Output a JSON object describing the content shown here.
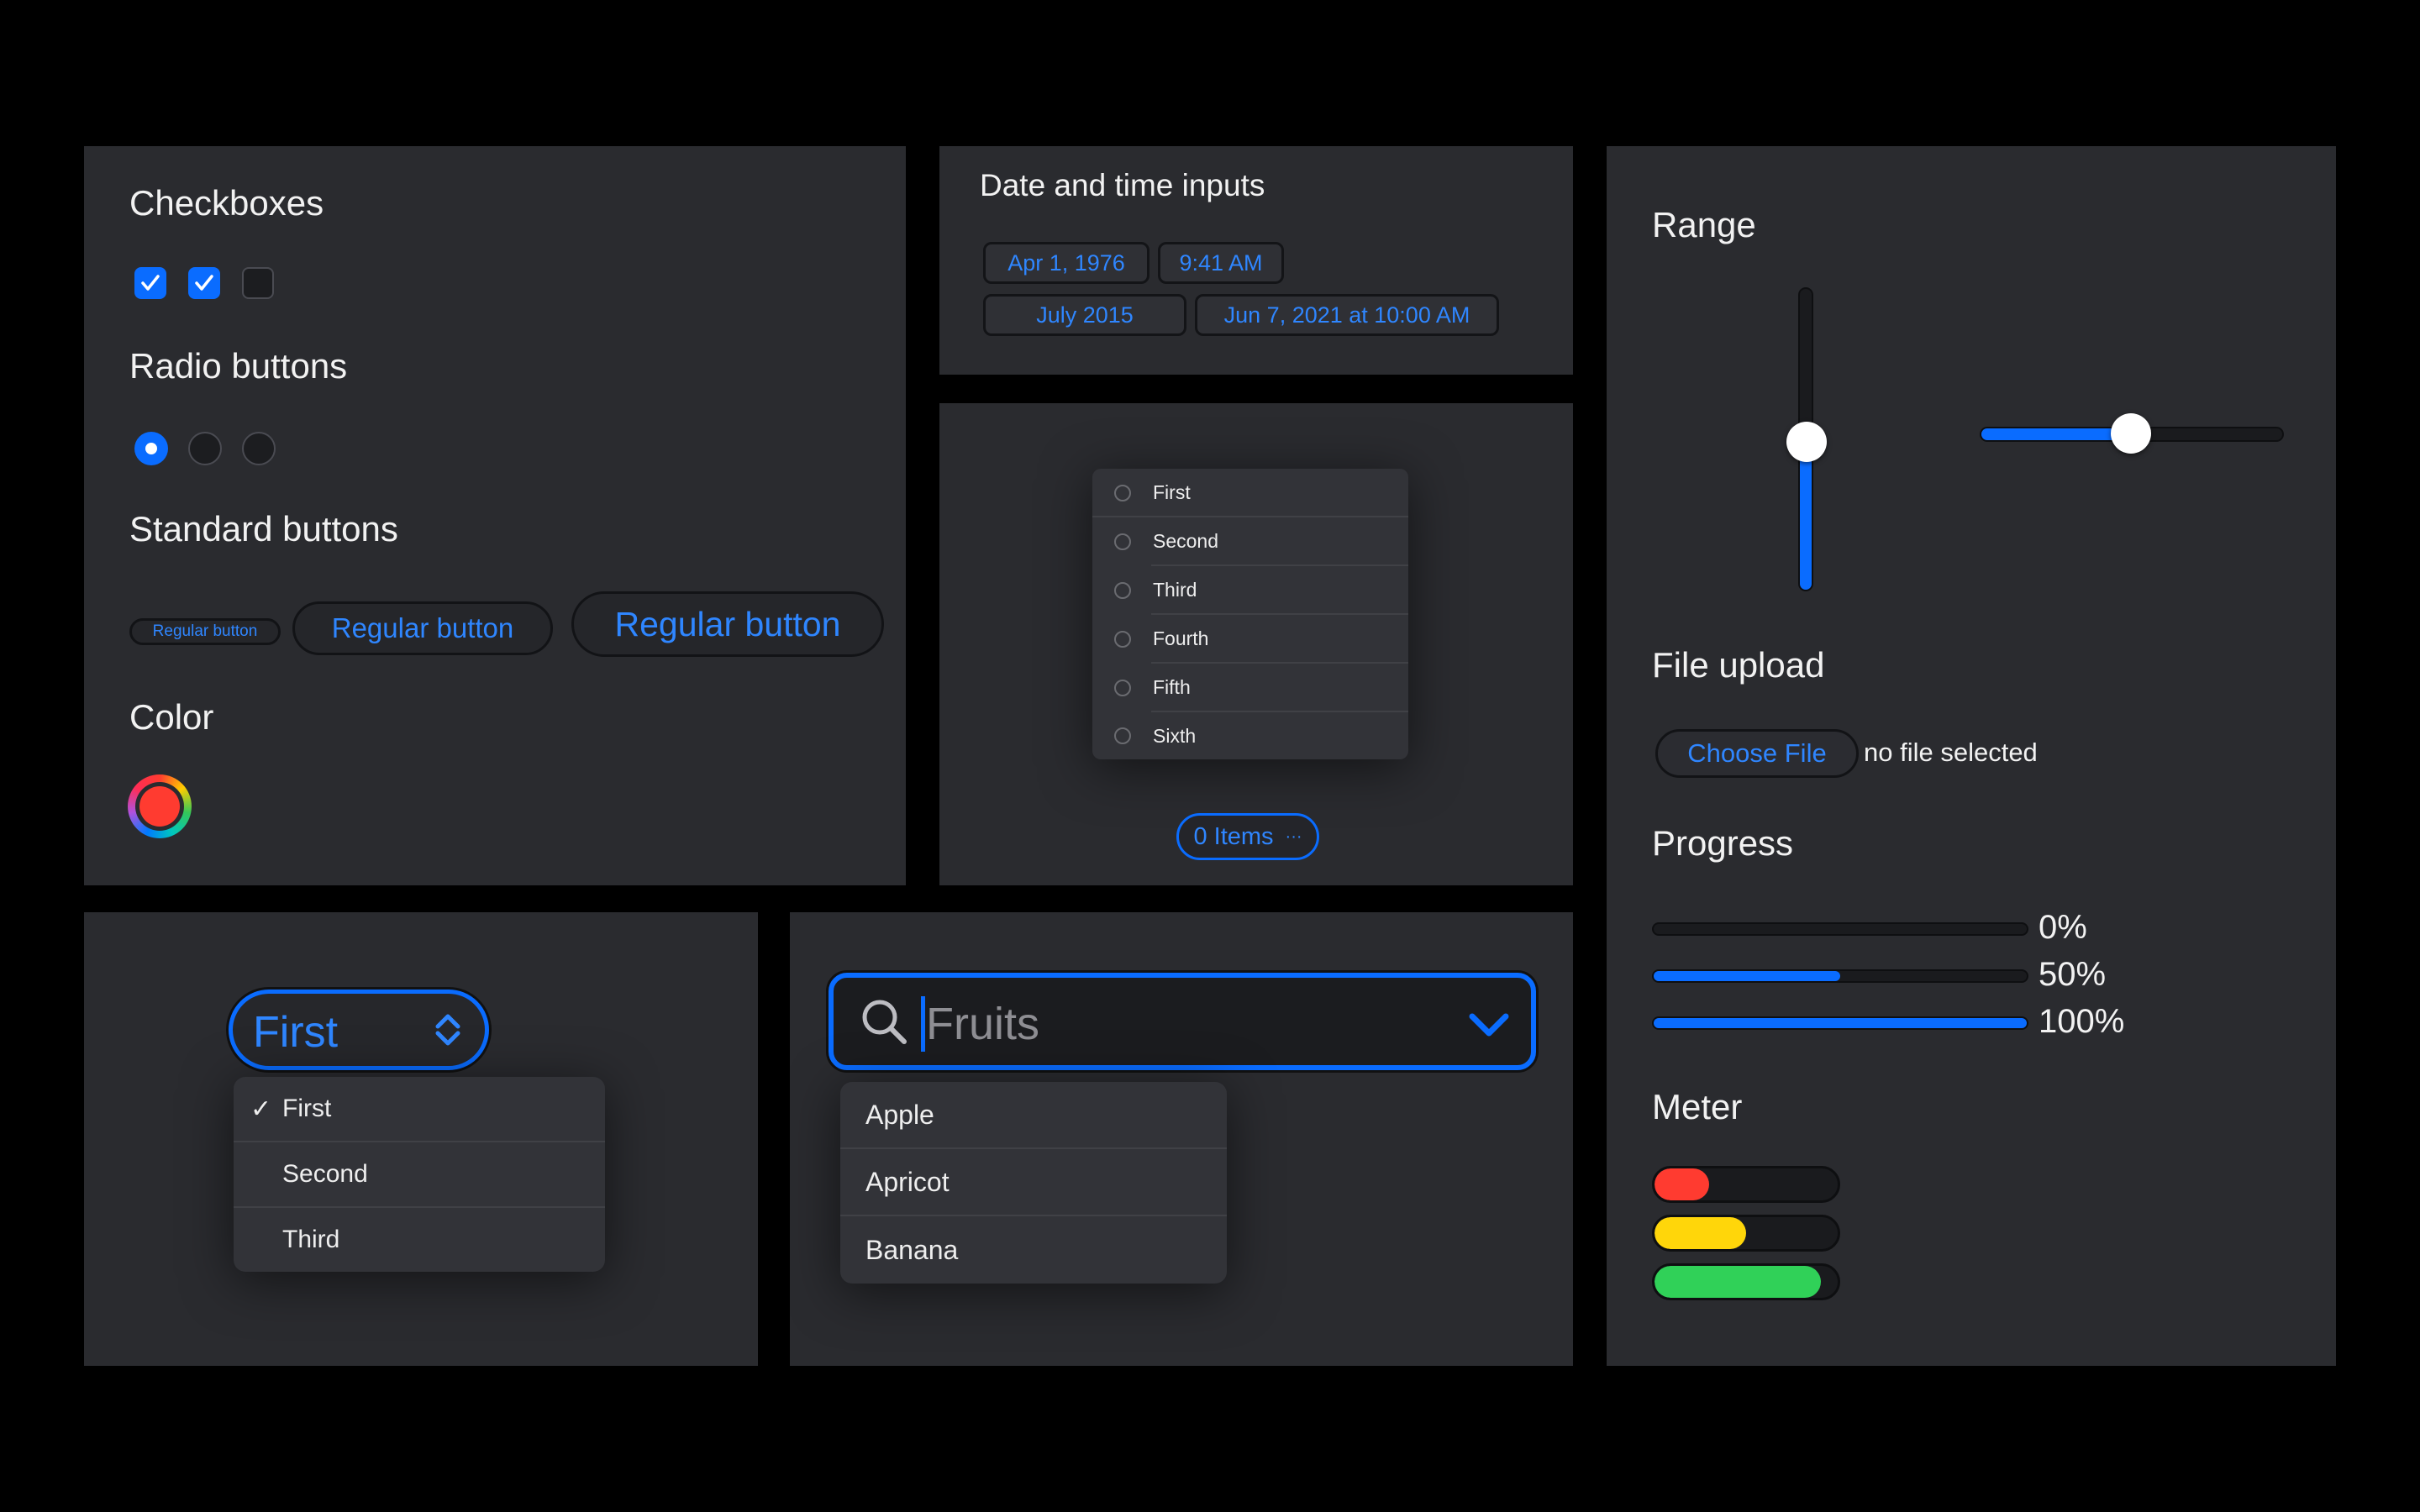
{
  "controls": {
    "checkboxes_title": "Checkboxes",
    "checkboxes": [
      true,
      true,
      false
    ],
    "radios_title": "Radio buttons",
    "radios": [
      true,
      false,
      false
    ],
    "buttons_title": "Standard buttons",
    "button_small": "Regular button",
    "button_medium": "Regular button",
    "button_large": "Regular button",
    "color_title": "Color",
    "color_value": "#ff3b30"
  },
  "datetime": {
    "title": "Date and time inputs",
    "date": "Apr 1, 1976",
    "time": "9:41 AM",
    "month": "July 2015",
    "datetime_local": "Jun 7, 2021 at 10:00 AM"
  },
  "multiselect": {
    "options": [
      "First",
      "Second",
      "Third",
      "Fourth",
      "Fifth",
      "Sixth"
    ],
    "summary": "0 Items",
    "more_glyph": "···"
  },
  "range": {
    "title": "Range",
    "vertical_value": 0.5,
    "horizontal_value": 0.5
  },
  "file_upload": {
    "title": "File upload",
    "button": "Choose File",
    "status": "no file selected"
  },
  "progress": {
    "title": "Progress",
    "bars": [
      {
        "value": 0,
        "label": "0%"
      },
      {
        "value": 0.5,
        "label": "50%"
      },
      {
        "value": 1,
        "label": "100%"
      }
    ]
  },
  "meter": {
    "title": "Meter",
    "bars": [
      {
        "value": 0.3,
        "color": "#ff3b30"
      },
      {
        "value": 0.5,
        "color": "#ffd60a"
      },
      {
        "value": 0.91,
        "color": "#30d158"
      }
    ]
  },
  "select": {
    "value": "First",
    "options": [
      "First",
      "Second",
      "Third"
    ],
    "checkmark": "✓"
  },
  "combobox": {
    "placeholder": "Fruits",
    "options": [
      "Apple",
      "Apricot",
      "Banana"
    ]
  },
  "colors": {
    "accent": "#0a6cff",
    "panel": "#2a2b2f"
  }
}
